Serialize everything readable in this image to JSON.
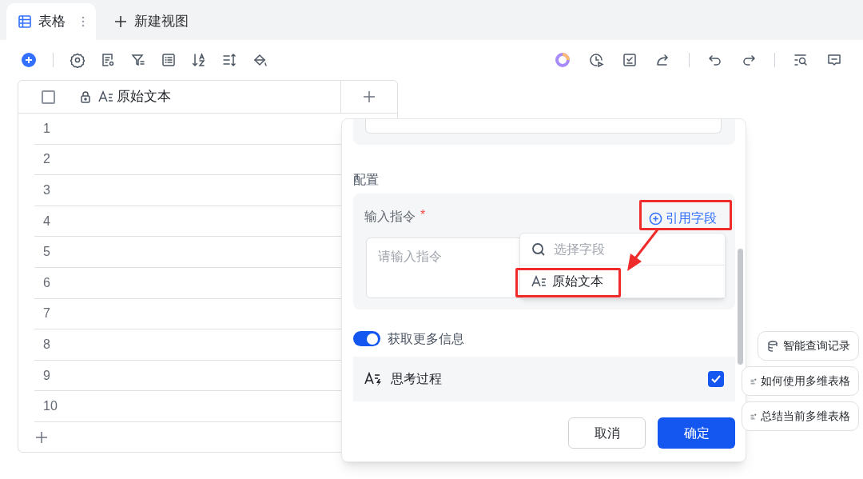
{
  "tabs": [
    {
      "label": "表格",
      "selected": true,
      "kind": "view"
    },
    {
      "label": "新建视图",
      "selected": false,
      "kind": "new"
    }
  ],
  "table": {
    "select_all_checked": false,
    "columns": [
      "原始文本"
    ],
    "rows": [
      "1",
      "2",
      "3",
      "4",
      "5",
      "6",
      "7",
      "8",
      "9",
      "10"
    ]
  },
  "dialog": {
    "section": "配置",
    "field_label": "输入指令",
    "required_mark": "*",
    "reference_button": "引用字段",
    "input": {
      "placeholder": "请输入指令"
    },
    "dropdown": {
      "search_placeholder": "选择字段",
      "options": [
        {
          "label": "原始文本",
          "highlighted": true
        }
      ]
    },
    "toggle": {
      "label": "获取更多信息",
      "on": true
    },
    "options": [
      {
        "label": "思考过程",
        "checked": true
      }
    ],
    "buttons": [
      {
        "label": "取消",
        "kind": "secondary"
      },
      {
        "label": "确定",
        "kind": "primary"
      }
    ]
  },
  "suggestions": [
    "智能查询记录",
    "如何使用多维表格",
    "总结当前多维表格"
  ]
}
